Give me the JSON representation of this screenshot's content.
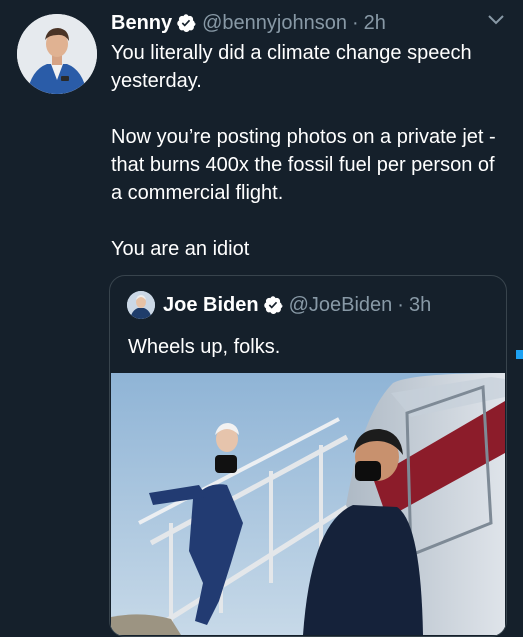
{
  "tweet": {
    "author_name": "Benny",
    "author_handle": "@bennyjohnson",
    "separator": "·",
    "time": "2h",
    "paragraphs": [
      "You literally did a climate change speech yesterday.",
      "Now you’re posting photos on a private jet - that burns 400x the fossil fuel per person of a commercial flight.",
      "You are an idiot"
    ]
  },
  "quoted_tweet": {
    "author_name": "Joe Biden",
    "author_handle": "@JoeBiden",
    "separator": "·",
    "time": "3h",
    "text": "Wheels up, folks."
  },
  "icons": {
    "verified": "verified-badge-icon",
    "more": "chevron-down-icon"
  },
  "colors": {
    "background": "#15202b",
    "secondary_text": "#8899a6",
    "border": "#38444d",
    "accent": "#1da1f2"
  }
}
